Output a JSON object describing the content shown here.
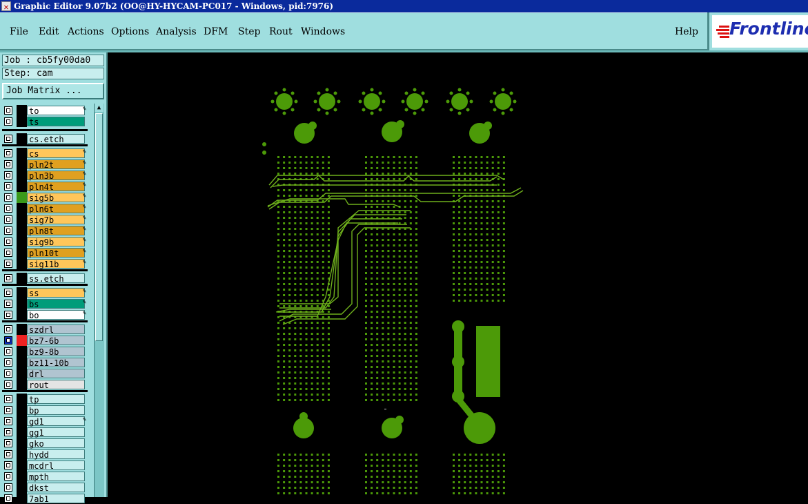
{
  "window": {
    "title": "Graphic Editor 9.07b2 (OO@HY-HYCAM-PC017 - Windows, pid:7976)"
  },
  "menu": {
    "items": [
      "File",
      "Edit",
      "Actions",
      "Options",
      "Analysis",
      "DFM",
      "Step",
      "Rout",
      "Windows"
    ],
    "help": "Help"
  },
  "brand": {
    "logo": "Frontline"
  },
  "job": {
    "label": "Job : cb5fy00da0",
    "step": "Step: cam",
    "matrix_button": "Job Matrix ..."
  },
  "layers": [
    {
      "name": "to",
      "bg": "#ffffff",
      "lock": true
    },
    {
      "name": "ts",
      "bg": "#009c7a",
      "lock": false
    },
    {
      "name": "cs.etch",
      "bg": "#c8eeee",
      "lock": false
    },
    {
      "name": "cs",
      "bg": "#ffc65a",
      "lock": true
    },
    {
      "name": "pln2t",
      "bg": "#e0a020",
      "lock": true
    },
    {
      "name": "pln3b",
      "bg": "#e0a020",
      "lock": true
    },
    {
      "name": "pln4t",
      "bg": "#e0a020",
      "lock": true
    },
    {
      "name": "sig5b",
      "bg": "#ffc65a",
      "lock": true,
      "color": "#3a9a1a"
    },
    {
      "name": "pln6t",
      "bg": "#e0a020",
      "lock": true
    },
    {
      "name": "sig7b",
      "bg": "#ffc65a",
      "lock": true
    },
    {
      "name": "pln8t",
      "bg": "#e0a020",
      "lock": true
    },
    {
      "name": "sig9b",
      "bg": "#ffc65a",
      "lock": true
    },
    {
      "name": "pln10t",
      "bg": "#e0a020",
      "lock": true
    },
    {
      "name": "sig11b",
      "bg": "#ffc65a",
      "lock": true
    },
    {
      "name": "ss.etch",
      "bg": "#c8eeee",
      "lock": false
    },
    {
      "name": "ss",
      "bg": "#ffc65a",
      "lock": true
    },
    {
      "name": "bs",
      "bg": "#009c7a",
      "lock": true
    },
    {
      "name": "bo",
      "bg": "#ffffff",
      "lock": true
    },
    {
      "name": "szdrl",
      "bg": "#b0c4d0",
      "lock": false
    },
    {
      "name": "bz7-6b",
      "bg": "#b0c4d0",
      "lock": false,
      "color": "#ee2222",
      "selected": true
    },
    {
      "name": "bz9-8b",
      "bg": "#b0c4d0",
      "lock": false
    },
    {
      "name": "bz11-10b",
      "bg": "#b0c4d0",
      "lock": false
    },
    {
      "name": "drl",
      "bg": "#b0c4d0",
      "lock": false
    },
    {
      "name": "rout",
      "bg": "#e4e4e4",
      "lock": false
    },
    {
      "name": "tp",
      "bg": "#c8eeee",
      "lock": false
    },
    {
      "name": "bp",
      "bg": "#c8eeee",
      "lock": false
    },
    {
      "name": "gd1",
      "bg": "#c8eeee",
      "lock": true
    },
    {
      "name": "gg1",
      "bg": "#c8eeee",
      "lock": false
    },
    {
      "name": "gko",
      "bg": "#c8eeee",
      "lock": false
    },
    {
      "name": "hydd",
      "bg": "#c8eeee",
      "lock": false
    },
    {
      "name": "mcdrl",
      "bg": "#c8eeee",
      "lock": false
    },
    {
      "name": "mpth",
      "bg": "#c8eeee",
      "lock": false
    },
    {
      "name": "dkst",
      "bg": "#c8eeee",
      "lock": false
    },
    {
      "name": "7ab1",
      "bg": "#c8eeee",
      "lock": false
    }
  ],
  "colors": {
    "pcb_feature": "#4c9a08",
    "background": "#000000",
    "panel": "#9fdedf"
  }
}
